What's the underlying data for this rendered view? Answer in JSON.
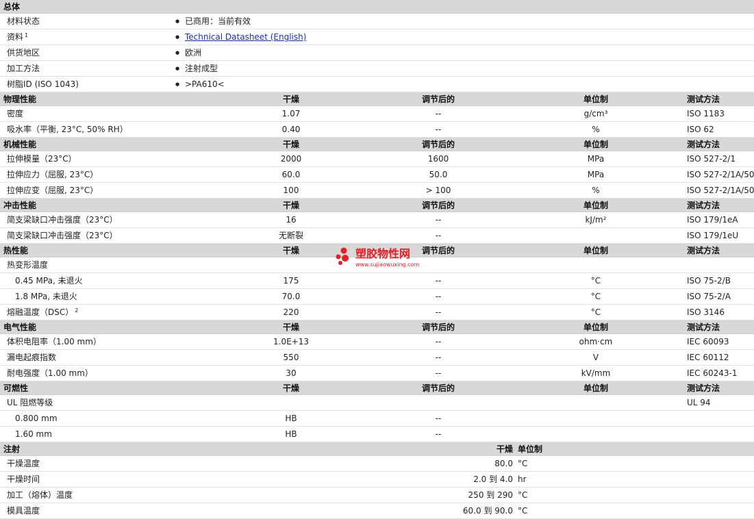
{
  "general": {
    "title": "总体",
    "rows": [
      {
        "label": "材料状态",
        "value": "已商用：当前有效"
      },
      {
        "label": "资料",
        "sup": "1",
        "link": "Technical Datasheet (English)"
      },
      {
        "label": "供货地区",
        "value": "欧洲"
      },
      {
        "label": "加工方法",
        "value": "注射成型"
      },
      {
        "label": "树脂ID (ISO 1043)",
        "value": ">PA610<"
      }
    ]
  },
  "col_headers": {
    "dry": "干燥",
    "conditioned": "调节后的",
    "unit": "单位制",
    "method": "测试方法"
  },
  "physical": {
    "title": "物理性能",
    "rows": [
      {
        "label": "密度",
        "dry": "1.07",
        "cond": "--",
        "unit": "g/cm³",
        "method": "ISO 1183"
      },
      {
        "label": "吸水率（平衡, 23°C, 50% RH）",
        "dry": "0.40",
        "cond": "--",
        "unit": "%",
        "method": "ISO 62"
      }
    ]
  },
  "mechanical": {
    "title": "机械性能",
    "rows": [
      {
        "label": "拉伸模量（23°C）",
        "dry": "2000",
        "cond": "1600",
        "unit": "MPa",
        "method": "ISO 527-2/1"
      },
      {
        "label": "拉伸应力（屈服, 23°C）",
        "dry": "60.0",
        "cond": "50.0",
        "unit": "MPa",
        "method": "ISO 527-2/1A/50"
      },
      {
        "label": "拉伸应变（屈服, 23°C）",
        "dry": "100",
        "cond": "> 100",
        "unit": "%",
        "method": "ISO 527-2/1A/50"
      }
    ]
  },
  "impact": {
    "title": "冲击性能",
    "rows": [
      {
        "label": "简支梁缺口冲击强度（23°C）",
        "dry": "16",
        "cond": "--",
        "unit": "kJ/m²",
        "method": "ISO 179/1eA"
      },
      {
        "label": "简支梁缺口冲击强度（23°C）",
        "dry": "无断裂",
        "cond": "--",
        "unit": "",
        "method": "ISO 179/1eU"
      }
    ]
  },
  "thermal": {
    "title": "热性能",
    "rows": [
      {
        "label": "热变形温度",
        "dry": "",
        "cond": "",
        "unit": "",
        "method": ""
      },
      {
        "label": "0.45 MPa, 未退火",
        "indent": true,
        "dry": "175",
        "cond": "--",
        "unit": "°C",
        "method": "ISO 75-2/B"
      },
      {
        "label": "1.8 MPa, 未退火",
        "indent": true,
        "dry": "70.0",
        "cond": "--",
        "unit": "°C",
        "method": "ISO 75-2/A"
      },
      {
        "label": "熔融温度（DSC）",
        "sup": "2",
        "dry": "220",
        "cond": "--",
        "unit": "°C",
        "method": "ISO 3146"
      }
    ]
  },
  "electrical": {
    "title": "电气性能",
    "rows": [
      {
        "label": "体积电阻率（1.00 mm）",
        "dry": "1.0E+13",
        "cond": "--",
        "unit": "ohm·cm",
        "method": "IEC 60093"
      },
      {
        "label": "漏电起痕指数",
        "dry": "550",
        "cond": "--",
        "unit": "V",
        "method": "IEC 60112"
      },
      {
        "label": "耐电强度（1.00 mm）",
        "dry": "30",
        "cond": "--",
        "unit": "kV/mm",
        "method": "IEC 60243-1"
      }
    ]
  },
  "flammability": {
    "title": "可燃性",
    "rows": [
      {
        "label": "UL 阻燃等级",
        "dry": "",
        "cond": "",
        "unit": "",
        "method": "UL 94"
      },
      {
        "label": "0.800 mm",
        "indent": true,
        "dry": "HB",
        "cond": "--",
        "unit": "",
        "method": ""
      },
      {
        "label": "1.60 mm",
        "indent": true,
        "dry": "HB",
        "cond": "--",
        "unit": "",
        "method": ""
      }
    ]
  },
  "injection": {
    "title": "注射",
    "dry_header": "干燥",
    "unit_header": "单位制",
    "rows": [
      {
        "label": "干燥温度",
        "value": "80.0",
        "unit": "°C"
      },
      {
        "label": "干燥时间",
        "value": "2.0 到 4.0",
        "unit": "hr"
      },
      {
        "label": "加工（熔体）温度",
        "value": "250 到 290",
        "unit": "°C"
      },
      {
        "label": "模具温度",
        "value": "60.0 到 90.0",
        "unit": "°C"
      }
    ]
  },
  "watermark": {
    "name": "塑胶物性网",
    "url": "www.sujiaowuxing.com"
  }
}
